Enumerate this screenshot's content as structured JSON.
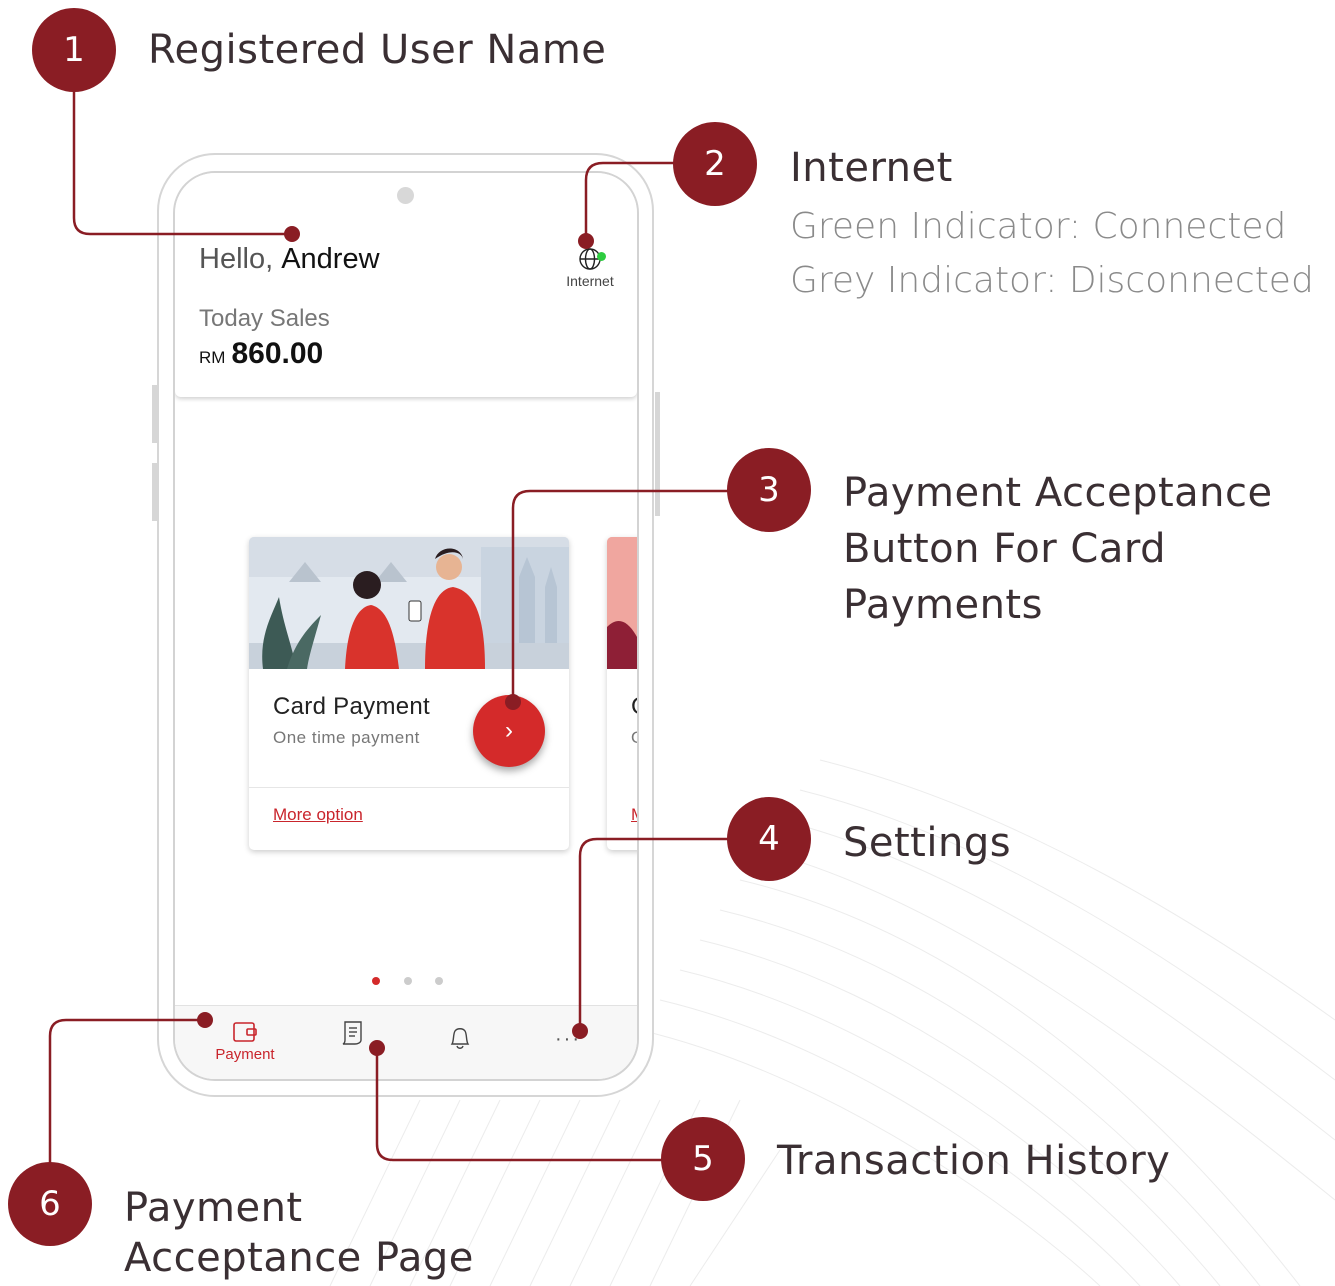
{
  "callouts": [
    {
      "number": "1",
      "title": "Registered User Name"
    },
    {
      "number": "2",
      "title": "Internet",
      "lines": [
        "Green Indicator: Connected",
        "Grey Indicator: Disconnected"
      ]
    },
    {
      "number": "3",
      "title_lines": [
        "Payment Acceptance",
        "Button For Card",
        "Payments"
      ]
    },
    {
      "number": "4",
      "title": "Settings"
    },
    {
      "number": "5",
      "title": "Transaction History"
    },
    {
      "number": "6",
      "title_lines": [
        "Payment",
        "Acceptance Page"
      ]
    }
  ],
  "app": {
    "greeting_prefix": "Hello, ",
    "user_name": "Andrew",
    "internet_label": "Internet",
    "internet_status_color": "#2ecc40",
    "today_sales_label": "Today Sales",
    "currency": "RM",
    "today_sales_amount": "860.00",
    "cards": [
      {
        "title": "Card Payment",
        "subtitle": "One time payment",
        "more_label": "More option"
      },
      {
        "title": "C",
        "subtitle": "O",
        "more_label": "M"
      }
    ],
    "pager": {
      "count": 3,
      "active": 0
    },
    "nav": [
      {
        "label": "Payment",
        "icon": "wallet-icon",
        "active": true
      },
      {
        "label": "",
        "icon": "receipt-icon",
        "active": false
      },
      {
        "label": "",
        "icon": "bell-icon",
        "active": false
      },
      {
        "label": "",
        "icon": "more-dots-icon",
        "active": false
      }
    ]
  },
  "colors": {
    "accent": "#8a1d24",
    "brand_red": "#d42a2a",
    "link_red": "#c9252c"
  }
}
